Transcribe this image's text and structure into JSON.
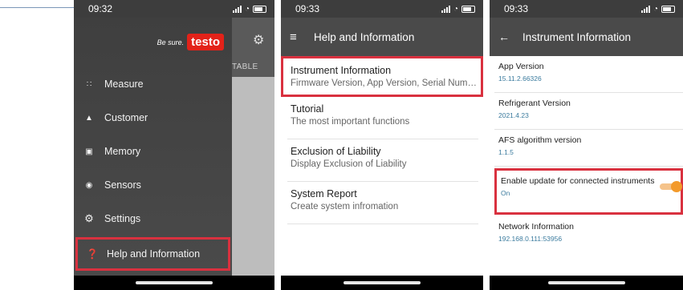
{
  "panel1": {
    "status": {
      "time": "09:32"
    },
    "brand": {
      "tagline": "Be sure.",
      "logo": "testo"
    },
    "behind": {
      "tab_fragment": "TABLE",
      "gear_icon": "gear-icon"
    },
    "menu": [
      {
        "label": "Measure",
        "icon": "grid-icon"
      },
      {
        "label": "Customer",
        "icon": "person-icon"
      },
      {
        "label": "Memory",
        "icon": "archive-icon"
      },
      {
        "label": "Sensors",
        "icon": "sensor-icon"
      },
      {
        "label": "Settings",
        "icon": "gear-icon"
      },
      {
        "label": "Help and Information",
        "icon": "help-icon",
        "highlighted": true
      }
    ]
  },
  "panel2": {
    "status": {
      "time": "09:33"
    },
    "header": {
      "title": "Help and Information",
      "menu_icon": "hamburger-icon"
    },
    "items": [
      {
        "title": "Instrument Information",
        "subtitle": "Firmware Version, App Version, Serial Number",
        "highlighted": true
      },
      {
        "title": "Tutorial",
        "subtitle": "The most important functions"
      },
      {
        "title": "Exclusion of Liability",
        "subtitle": "Display Exclusion of Liability"
      },
      {
        "title": "System Report",
        "subtitle": "Create system infromation"
      }
    ]
  },
  "panel3": {
    "status": {
      "time": "09:33"
    },
    "header": {
      "title": "Instrument Information",
      "back_icon": "back-arrow-icon"
    },
    "items": [
      {
        "title": "App Version",
        "value": "15.11.2.66326"
      },
      {
        "title": "Refrigerant Version",
        "value": "2021.4.23"
      },
      {
        "title": "AFS algorithm version",
        "value": "1.1.5"
      },
      {
        "title": "Enable update for connected instruments",
        "value": "On",
        "highlighted": true,
        "toggle_on": true
      },
      {
        "title": "Network Information",
        "value": "192.168.0.111:53956"
      }
    ]
  },
  "colors": {
    "highlight": "#d9313f",
    "brand": "#e32219",
    "toggle": "#f39a2b",
    "value_text": "#3b7b9e"
  }
}
